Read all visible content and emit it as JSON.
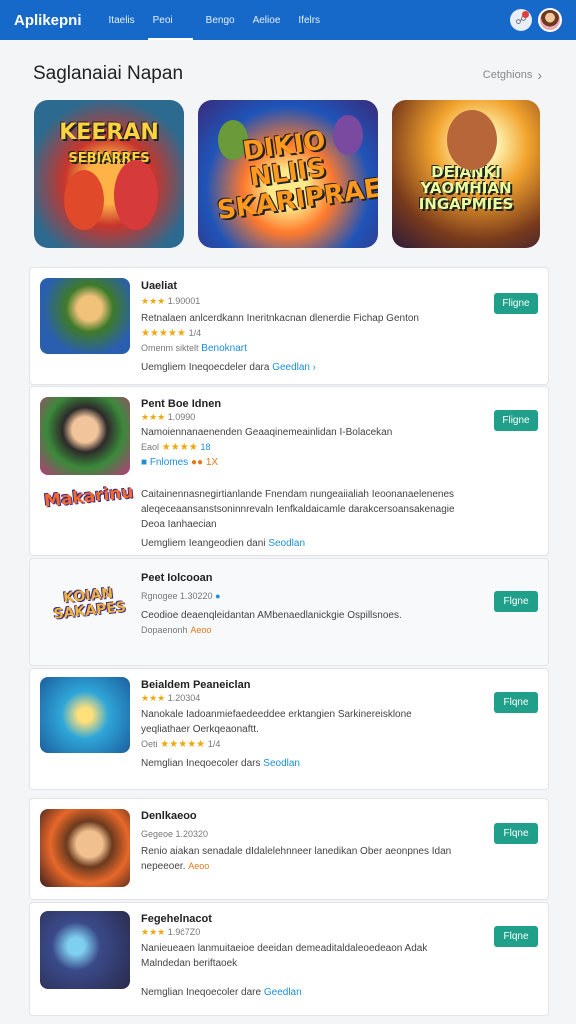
{
  "app": {
    "logo": "Aplikepni"
  },
  "nav": [
    {
      "label": "Itaelis"
    },
    {
      "label": "Peoi"
    },
    {
      "label": "Bengo"
    },
    {
      "label": "Aelioe"
    },
    {
      "label": "Ifelrs"
    }
  ],
  "section": {
    "title": "Saglanaiai Napan",
    "more": "Cetghions"
  },
  "banners": [
    {
      "title": "KEERAN",
      "subtitle": "SEBIARRES"
    },
    {
      "title": "DIKIO NLIIS SKARIPRAE"
    },
    {
      "title": "DEIANKI YAOMHIAN INGAPMIES"
    }
  ],
  "apps": [
    {
      "name": "Uaeliat",
      "meta_stars": "★★★",
      "meta": "1.90001",
      "desc": "Retnalaen anlcerdkann Ineritnkacnan dlenerdie Fichap Genton",
      "rating_stars": "★★★★★",
      "rating_text": "1/4",
      "dev_label": "Omenm siktelt",
      "dev_link": "Benoknart",
      "footer": "Uemgliem Ineqoecdeler dara",
      "footer_link": "Geedlan",
      "button": "Fligne"
    },
    {
      "name": "Pent Boe Idnen",
      "meta_stars": "★★★",
      "meta": "1.0990",
      "desc": "Namoiennanaenenden Geaaqinemeainlidan I-Bolacekan",
      "rating_stars": "★★★★",
      "rating_text": "Eaol",
      "rating_num": "18",
      "tag_link": "Fnlomes",
      "tag_rest": "1X",
      "extra_logo": "Makarinu",
      "extra1": "Caitainennasnegirtianlande Fnendam nungeaiialiah Ieoonanaelenenes",
      "extra2": "aleqeceaansanstsoninnrevaln Ienfkaldaicamle darakcersoansakenagie",
      "extra3": "Deoa Ianhaecian",
      "footer": "Uemgliem Ieangeodien dani",
      "footer_link": "Seodlan",
      "button": "Fligne"
    },
    {
      "name": "Peet Iolcooan",
      "logo_text": "KOIAN SAKAPES",
      "meta": "Rgnogee 1.30220",
      "desc": "Ceodioe deaenqleidantan AMbenaedlanickgie Ospillsnoes.",
      "label": "Dopaenonh",
      "label_orange": "Aeoo",
      "button": "Flgne"
    },
    {
      "name": "Beialdem Peaneiclan",
      "meta_stars": "★★★",
      "meta": "1.20304",
      "desc": "Nanokale Iadoanmiefaedeeddee erktangien Sarkinereisklone",
      "desc2": "yeqliathaer Oerkqeaonaftt.",
      "rating_prefix": "Oeti",
      "rating_stars": "★★★★★",
      "rating_text": "1/4",
      "footer": "Nemglian Ineqoecoler dars",
      "footer_link": "Seodlan",
      "button": "Flqne"
    },
    {
      "name": "Denlkaeoo",
      "meta": "Gegeoe 1.20320",
      "desc": "Renio aiakan senadale dIdalelehnneer lanedikan Ober aeonpnes Idan",
      "desc2": "nepeeoer.",
      "desc2_orange": "Aeoo",
      "button": "Flqne"
    },
    {
      "name": "Fegehelnacot",
      "meta_stars": "★★★",
      "meta": "1.9ĉ7Z0",
      "desc": "Nanieueaen lanmuitaeioe deeidan demeaditaldaleoedeaon Adak",
      "desc2": "Malndedan beriftaoek",
      "footer": "Nemglian Ineqoecoler dare",
      "footer_link": "Geedlan",
      "button": "Flqne"
    }
  ]
}
